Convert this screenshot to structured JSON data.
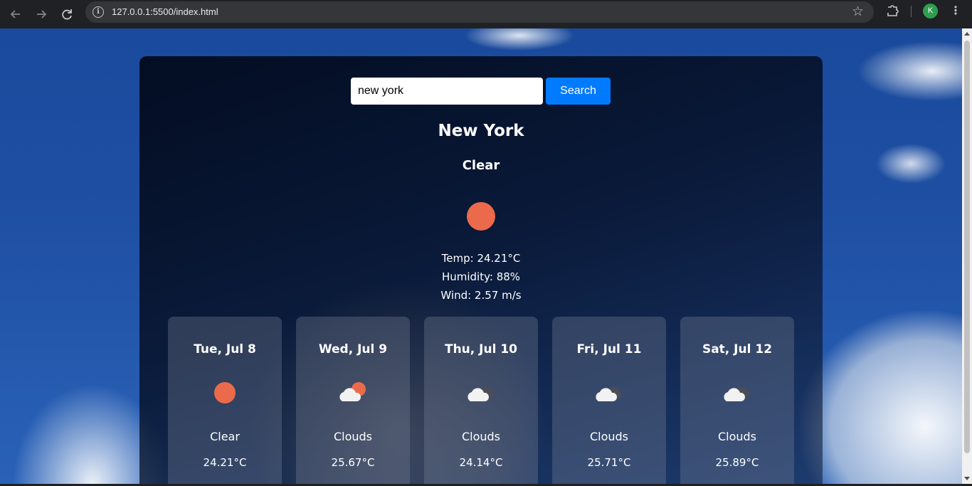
{
  "browser": {
    "url": "127.0.0.1:5500/index.html",
    "profile_initial": "K",
    "icons": [
      "back-arrow-icon",
      "forward-arrow-icon",
      "reload-icon",
      "site-info-icon",
      "bookmark-star-icon",
      "extensions-icon",
      "menu-kebab-icon"
    ]
  },
  "search": {
    "value": "new york",
    "button_label": "Search"
  },
  "current": {
    "city": "New York",
    "condition": "Clear",
    "icon": "sun-icon",
    "temp": "Temp: 24.21°C",
    "humidity": "Humidity: 88%",
    "wind": "Wind: 2.57 m/s"
  },
  "forecast": [
    {
      "date": "Tue, Jul 8",
      "icon": "sun-icon",
      "desc": "Clear",
      "temp": "24.21°C"
    },
    {
      "date": "Wed, Jul 9",
      "icon": "cloud-sun-icon",
      "desc": "Clouds",
      "temp": "25.67°C"
    },
    {
      "date": "Thu, Jul 10",
      "icon": "cloud-icon",
      "desc": "Clouds",
      "temp": "24.14°C"
    },
    {
      "date": "Fri, Jul 11",
      "icon": "cloud-icon",
      "desc": "Clouds",
      "temp": "25.71°C"
    },
    {
      "date": "Sat, Jul 12",
      "icon": "cloud-icon",
      "desc": "Clouds",
      "temp": "25.89°C"
    }
  ],
  "colors": {
    "accent": "#007bff",
    "sun": "#ec6a4c",
    "cloud": "#f2f2f2"
  }
}
